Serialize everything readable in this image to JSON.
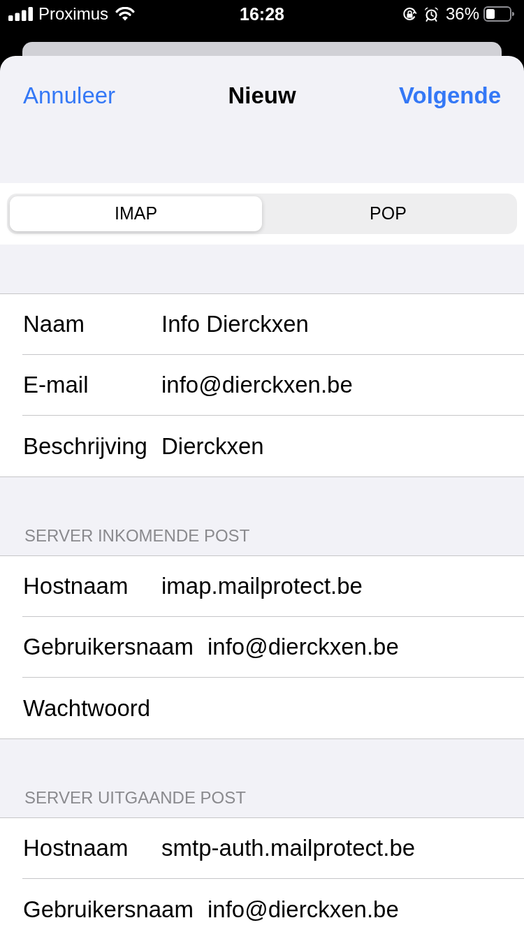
{
  "status_bar": {
    "carrier": "Proximus",
    "time": "16:28",
    "battery": "36%"
  },
  "nav_bar": {
    "cancel": "Annuleer",
    "title": "Nieuw",
    "next": "Volgende"
  },
  "account_type": {
    "segments": [
      {
        "label": "IMAP",
        "selected": true
      },
      {
        "label": "POP",
        "selected": false
      }
    ]
  },
  "sections": [
    {
      "rows": [
        {
          "label": "Naam",
          "value": "Info Dierckxen"
        },
        {
          "label": "E-mail",
          "value": "info@dierckxen.be"
        },
        {
          "label": "Beschrijving",
          "value": "Dierckxen"
        }
      ]
    },
    {
      "header": "SERVER INKOMENDE POST",
      "rows": [
        {
          "label": "Hostnaam",
          "value": "imap.mailprotect.be"
        },
        {
          "label": "Gebruikersnaam",
          "value": "info@dierckxen.be"
        },
        {
          "label": "Wachtwoord"
        }
      ]
    },
    {
      "header": "SERVER UITGAANDE POST",
      "rows": [
        {
          "label": "Hostnaam",
          "value": "smtp-auth.mailprotect.be"
        },
        {
          "label": "Gebruikersnaam",
          "value": "info@dierckxen.be"
        }
      ]
    }
  ]
}
